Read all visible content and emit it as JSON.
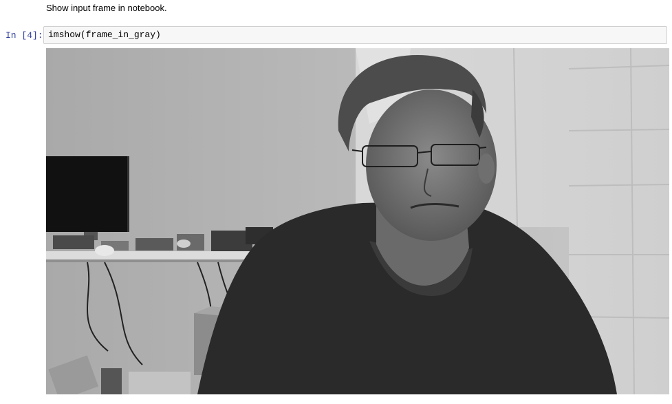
{
  "notebook": {
    "markdown_text": "Show input frame in notebook.",
    "cell": {
      "prompt": "In [4]:",
      "code": "imshow(frame_in_gray)"
    },
    "output": {
      "image_description_icon": "grayscale-webcam-frame"
    }
  }
}
